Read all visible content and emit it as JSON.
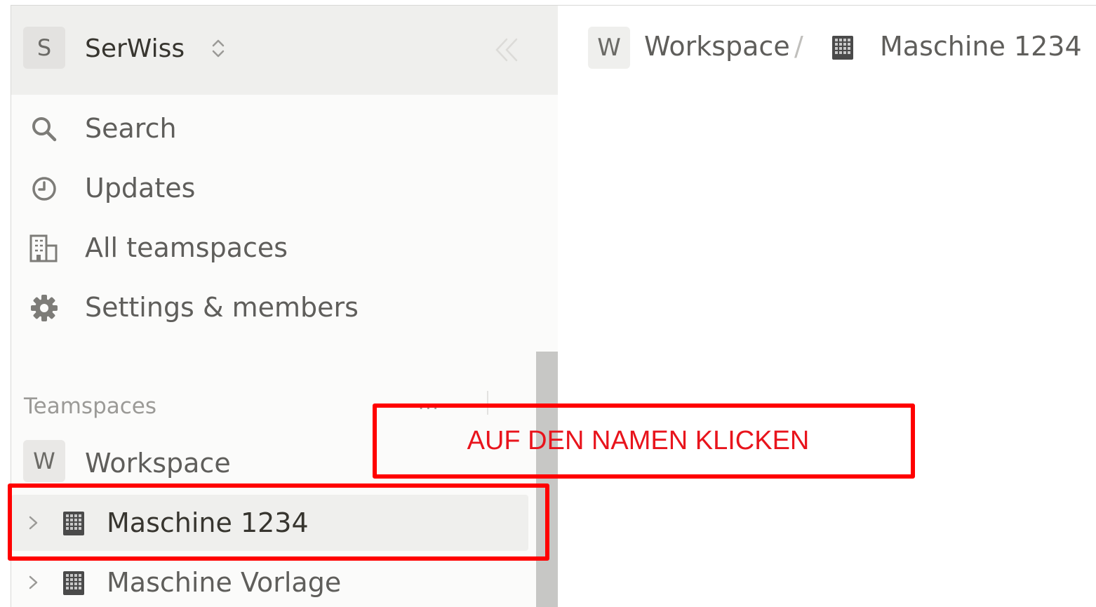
{
  "sidebar": {
    "workspace_initial": "S",
    "workspace_name": "SerWiss",
    "nav": [
      {
        "label": "Search",
        "icon": "search-icon"
      },
      {
        "label": "Updates",
        "icon": "clock-icon"
      },
      {
        "label": "All teamspaces",
        "icon": "buildings-icon"
      },
      {
        "label": "Settings & members",
        "icon": "gear-icon"
      }
    ],
    "section_label": "Teamspaces",
    "section_more": "...",
    "teamspace": {
      "initial": "W",
      "label": "Workspace"
    },
    "pages": [
      {
        "label": "Maschine 1234",
        "icon": "building-page-icon",
        "selected": true
      },
      {
        "label": "Maschine Vorlage",
        "icon": "building-page-icon",
        "selected": false
      }
    ]
  },
  "breadcrumb": {
    "workspace_initial": "W",
    "workspace_label": "Workspace",
    "separator": "/",
    "page_label": "Maschine 1234"
  },
  "annotation": {
    "instruction": "AUF DEN NAMEN KLICKEN",
    "color": "#ff0000"
  }
}
